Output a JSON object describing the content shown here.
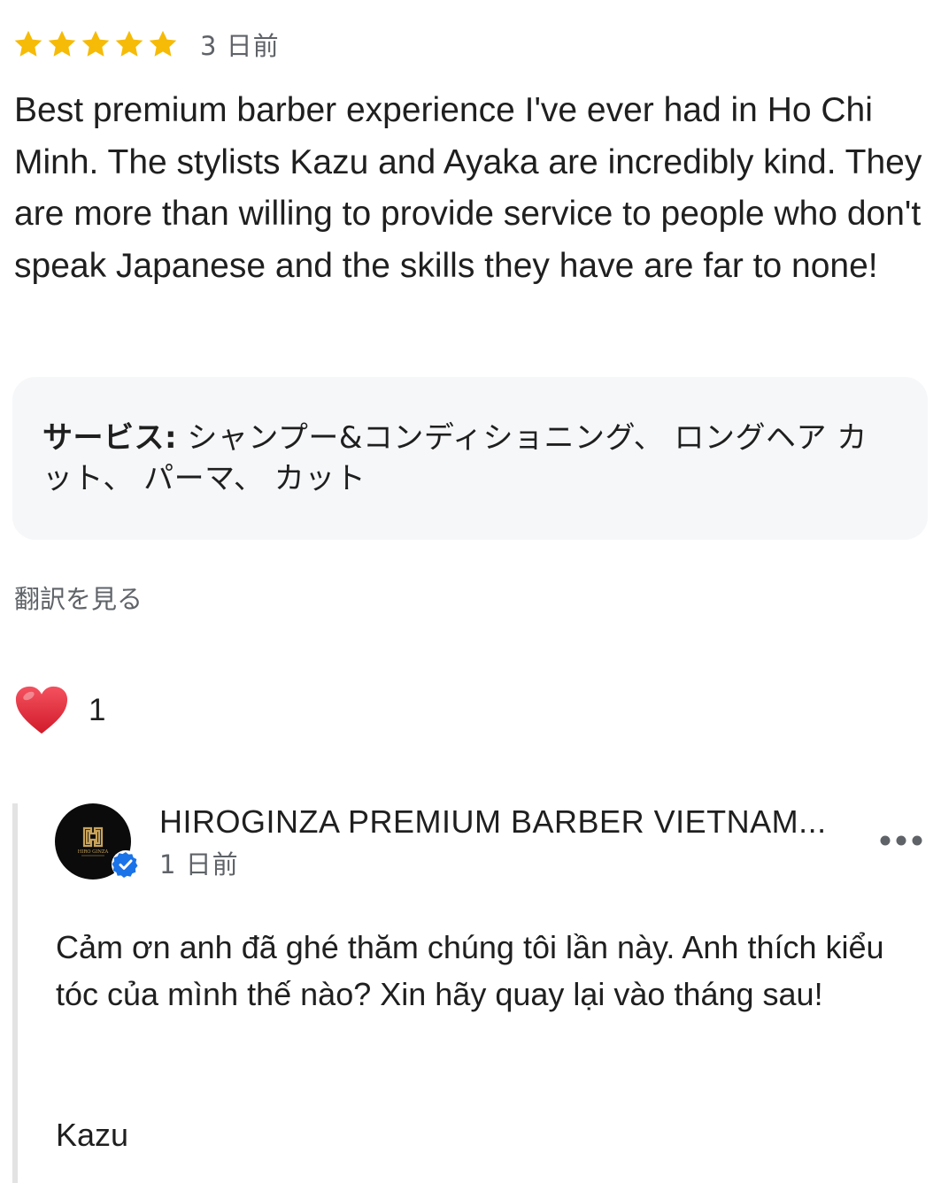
{
  "review": {
    "rating": 5,
    "rating_max": 5,
    "time_ago": "3 日前",
    "text": "Best premium barber experience I've ever had in Ho Chi Minh. The stylists Kazu and Ayaka are incredibly kind. They are more than willing to provide service to people who don't speak Japanese and the skills they have are far to none!",
    "star_color": "#f6bb06"
  },
  "services": {
    "label": "サービス:",
    "value": "シャンプー&コンディショニング、 ロングヘア カット、 パーマ、 カット"
  },
  "translate_link": "翻訳を見る",
  "reactions": {
    "icon": "heart-icon",
    "count": "1"
  },
  "owner_reply": {
    "name": "HIROGINZA PREMIUM BARBER VIETNAM...",
    "time_ago": "1 日前",
    "avatar_text": "HIRO GINZA",
    "verified_color": "#1a73e8",
    "more_icon": "more-horizontal-icon",
    "text": "Cảm ơn anh đã ghé thăm chúng tôi lần này. Anh thích kiểu tóc của mình thế nào? Xin hãy quay lại vào tháng sau!",
    "signature": "Kazu"
  }
}
